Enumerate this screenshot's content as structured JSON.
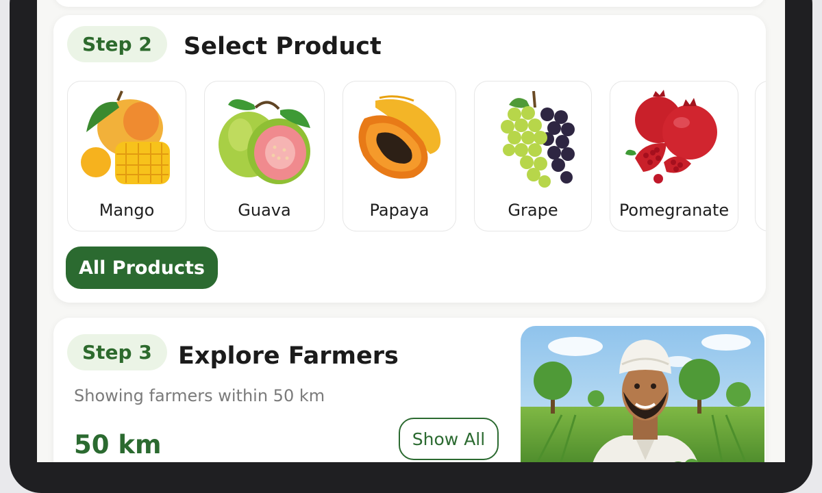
{
  "colors": {
    "accent_green": "#2b6a30",
    "pill_background": "#ebf4e6",
    "card_background": "#ffffff"
  },
  "step2": {
    "step_label": "Step 2",
    "title": "Select Product",
    "products": [
      {
        "label": "Mango",
        "icon": "mango-icon"
      },
      {
        "label": "Guava",
        "icon": "guava-icon"
      },
      {
        "label": "Papaya",
        "icon": "papaya-icon"
      },
      {
        "label": "Grape",
        "icon": "grape-icon"
      },
      {
        "label": "Pomegranate",
        "icon": "pomegranate-icon"
      }
    ],
    "all_products_label": "All Products"
  },
  "step3": {
    "step_label": "Step 3",
    "title": "Explore Farmers",
    "subtitle": "Showing farmers within 50 km",
    "radius_value": "50 km",
    "show_all_label": "Show All",
    "image": "farmer-illustration"
  }
}
